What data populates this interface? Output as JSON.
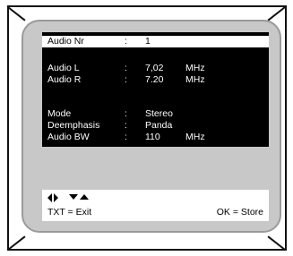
{
  "menu": {
    "rows": [
      {
        "label": "Audio Nr",
        "sep": ":",
        "value": "1",
        "unit": ""
      },
      {
        "label": "Audio L",
        "sep": ":",
        "value": "7,02",
        "unit": "MHz"
      },
      {
        "label": "Audio R",
        "sep": ":",
        "value": "7.20",
        "unit": "MHz"
      },
      {
        "label": "Mode",
        "sep": ":",
        "value": "Stereo",
        "unit": ""
      },
      {
        "label": "Deemphasis",
        "sep": ":",
        "value": "Panda",
        "unit": ""
      },
      {
        "label": "Audio BW",
        "sep": ":",
        "value": "110",
        "unit": "MHz"
      }
    ]
  },
  "footer": {
    "exit_label": "TXT = Exit",
    "store_label": "OK = Store"
  },
  "icons": {
    "nav_left_right": "left-right-arrows-icon",
    "nav_up_down": "down-up-arrows-icon"
  },
  "colors": {
    "panel_bg": "#000000",
    "screen_bg": "#c8c8c8",
    "highlight_bg": "#ffffff"
  }
}
